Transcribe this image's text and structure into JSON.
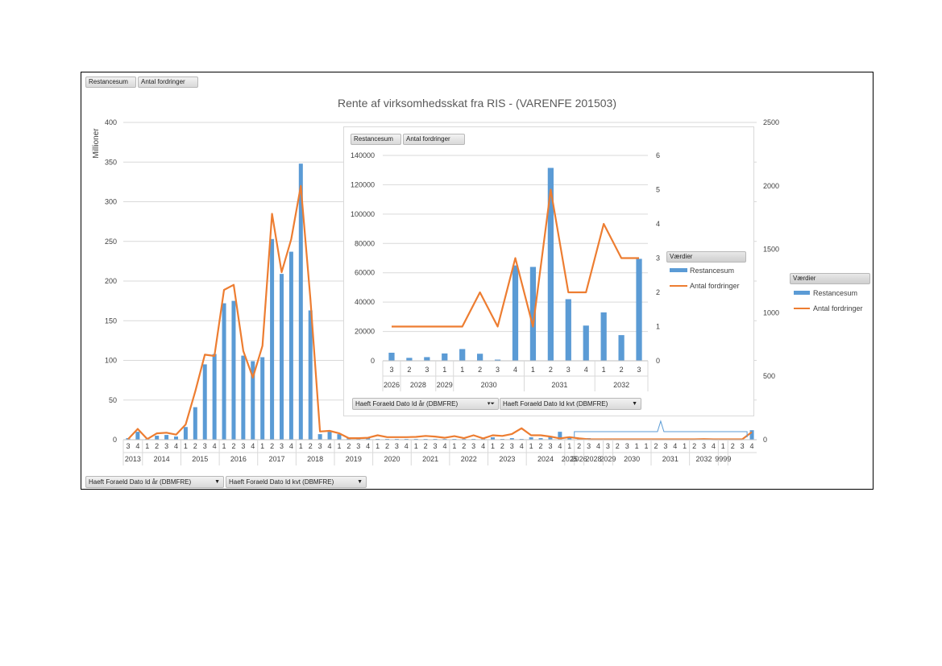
{
  "main": {
    "title": "Rente af virksomhedsskat fra RIS - (VARENFE 201503)",
    "field_buttons": [
      "Restancesum",
      "Antal fordringer"
    ],
    "y_axis_unit": "Millioner",
    "filters": [
      "Haeft Foraeld Dato Id år  (DBMFRE)",
      "Haeft Foraeld Dato Id kvt  (DBMFRE)"
    ],
    "legend_title": "Værdier",
    "legend_items": [
      "Restancesum",
      "Antal fordringer"
    ]
  },
  "inset": {
    "field_buttons": [
      "Restancesum",
      "Antal fordringer"
    ],
    "filters": [
      "Haeft Foraeld Dato Id år  (DBMFRE)",
      "Haeft Foraeld Dato Id kvt  (DBMFRE)"
    ],
    "legend_title": "Værdier",
    "legend_items": [
      "Restancesum",
      "Antal fordringer"
    ]
  },
  "chart_data": [
    {
      "type": "bar",
      "title": "Rente af virksomhedsskat fra RIS - (VARENFE 201503)",
      "ylabel": "Millioner",
      "ylim": [
        0,
        400
      ],
      "y_ticks": [
        0,
        50,
        100,
        150,
        200,
        250,
        300,
        350,
        400
      ],
      "y2lim": [
        0,
        2500
      ],
      "y2_ticks": [
        0,
        500,
        1000,
        1500,
        2000,
        2500
      ],
      "legend": "right",
      "grid": true,
      "categories": [
        "3",
        "4",
        "1",
        "2",
        "3",
        "4",
        "1",
        "2",
        "3",
        "4",
        "1",
        "2",
        "3",
        "4",
        "1",
        "2",
        "3",
        "4",
        "1",
        "2",
        "3",
        "4",
        "1",
        "2",
        "3",
        "4",
        "1",
        "2",
        "3",
        "4",
        "1",
        "2",
        "3",
        "4",
        "1",
        "2",
        "3",
        "4",
        "1",
        "2",
        "3",
        "4",
        "1",
        "2",
        "3",
        "4",
        "1",
        "2",
        "3",
        "4",
        "3",
        "2",
        "3",
        "1",
        "1",
        "2",
        "3",
        "4",
        "1",
        "2",
        "3",
        "4",
        "1",
        "2",
        "3",
        "4"
      ],
      "groups": [
        {
          "label": "2013",
          "count": 2
        },
        {
          "label": "2014",
          "count": 4
        },
        {
          "label": "2015",
          "count": 4
        },
        {
          "label": "2016",
          "count": 4
        },
        {
          "label": "2017",
          "count": 4
        },
        {
          "label": "2018",
          "count": 4
        },
        {
          "label": "2019",
          "count": 4
        },
        {
          "label": "2020",
          "count": 4
        },
        {
          "label": "2021",
          "count": 4
        },
        {
          "label": "2022",
          "count": 4
        },
        {
          "label": "2023",
          "count": 4
        },
        {
          "label": "2024",
          "count": 4
        },
        {
          "label": "2025",
          "count": 1
        },
        {
          "label": "2026",
          "count": 1
        },
        {
          "label": "2028",
          "count": 2
        },
        {
          "label": "2029",
          "count": 1
        },
        {
          "label": "2030",
          "count": 4
        },
        {
          "label": "2031",
          "count": 4
        },
        {
          "label": "2032",
          "count": 3
        },
        {
          "label": "9999",
          "count": 1
        }
      ],
      "series": [
        {
          "name": "Restancesum",
          "kind": "bar",
          "axis": "left",
          "color": "#5b9bd5",
          "values": [
            2,
            10,
            1,
            5,
            6,
            4,
            16,
            41,
            95,
            108,
            172,
            175,
            106,
            99,
            104,
            253,
            209,
            237,
            348,
            163,
            7,
            10,
            7,
            2,
            2,
            3,
            1,
            1,
            1,
            1,
            1,
            1,
            1,
            1,
            1,
            1,
            1,
            1,
            3,
            1,
            2,
            1,
            3,
            2,
            4,
            10,
            2,
            2,
            2,
            1,
            1,
            0.01,
            0,
            0,
            0,
            0.01,
            0,
            0,
            0,
            0,
            0,
            0,
            0,
            0,
            0,
            12
          ]
        },
        {
          "name": "Antal fordringer",
          "kind": "line",
          "axis": "right",
          "color": "#ed7d31",
          "values": [
            5,
            85,
            5,
            50,
            55,
            40,
            120,
            380,
            670,
            660,
            1180,
            1220,
            700,
            490,
            740,
            1780,
            1320,
            1580,
            2000,
            1110,
            65,
            70,
            50,
            12,
            12,
            15,
            35,
            20,
            20,
            20,
            22,
            30,
            25,
            15,
            28,
            12,
            35,
            10,
            35,
            30,
            45,
            90,
            35,
            35,
            25,
            10,
            20,
            10,
            3,
            3,
            3,
            3,
            3,
            3,
            3,
            3,
            3,
            3,
            3,
            3,
            5,
            3,
            3,
            3,
            3,
            60
          ]
        }
      ],
      "annotations": [
        "brace marking 2026–2032 range expanded in inset"
      ]
    },
    {
      "type": "bar",
      "ylim": [
        0,
        140000
      ],
      "y_ticks": [
        0,
        20000,
        40000,
        60000,
        80000,
        100000,
        120000,
        140000
      ],
      "y2lim": [
        0,
        6
      ],
      "y2_ticks": [
        0,
        1,
        2,
        3,
        4,
        5,
        6
      ],
      "legend": "right",
      "grid": true,
      "categories": [
        "3",
        "2",
        "3",
        "1",
        "1",
        "2",
        "3",
        "4",
        "1",
        "2",
        "3",
        "4",
        "1",
        "2",
        "3"
      ],
      "groups": [
        {
          "label": "2026",
          "count": 1
        },
        {
          "label": "2028",
          "count": 2
        },
        {
          "label": "2029",
          "count": 1
        },
        {
          "label": "2030",
          "count": 4
        },
        {
          "label": "2031",
          "count": 4
        },
        {
          "label": "2032",
          "count": 3
        }
      ],
      "series": [
        {
          "name": "Restancesum",
          "kind": "bar",
          "axis": "left",
          "color": "#5b9bd5",
          "values": [
            5500,
            2000,
            2500,
            5000,
            8000,
            4800,
            800,
            65000,
            64000,
            131500,
            42000,
            24000,
            33000,
            17500,
            69500
          ]
        },
        {
          "name": "Antal fordringer",
          "kind": "line",
          "axis": "right",
          "color": "#ed7d31",
          "values": [
            1,
            1,
            1,
            1,
            1,
            2,
            1,
            3,
            1,
            5,
            2,
            2,
            4,
            3,
            3
          ]
        }
      ]
    }
  ]
}
